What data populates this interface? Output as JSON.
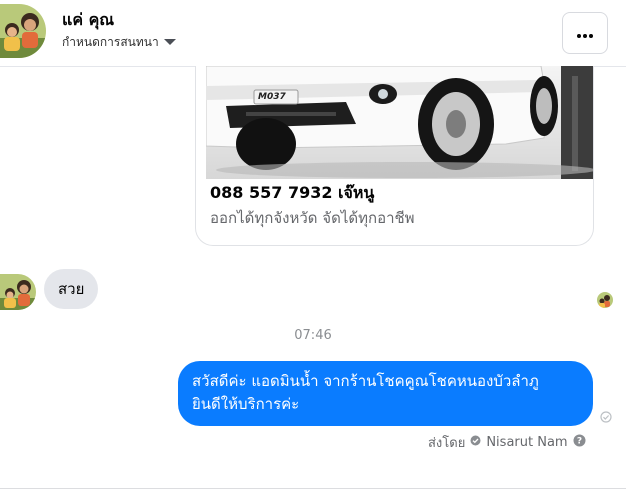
{
  "header": {
    "contact_name": "แค่ คุณ",
    "settings_label": "กำหนดการสนทนา",
    "more_icon": "more-horizontal-icon"
  },
  "shared_card": {
    "plate": "M037",
    "title": "088 557 7932 เจ๊หนู",
    "subtitle": "ออกได้ทุกจังหวัด จัดได้ทุกอาชีพ"
  },
  "messages": {
    "incoming_text": "สวย",
    "timestamp": "07:46",
    "outgoing_line1": "สวัสดีค่ะ แอดมินน้ำ จากร้านโชคคูณโชคหนองบัวลำภู",
    "outgoing_line2": "ยินดีให้บริการค่ะ",
    "sent_by_label": "ส่งโดย",
    "sender_name": "Nisarut Nam"
  },
  "colors": {
    "outgoing_bubble": "#0a7cff",
    "incoming_bubble": "#e4e6eb",
    "muted_text": "#65676b"
  }
}
